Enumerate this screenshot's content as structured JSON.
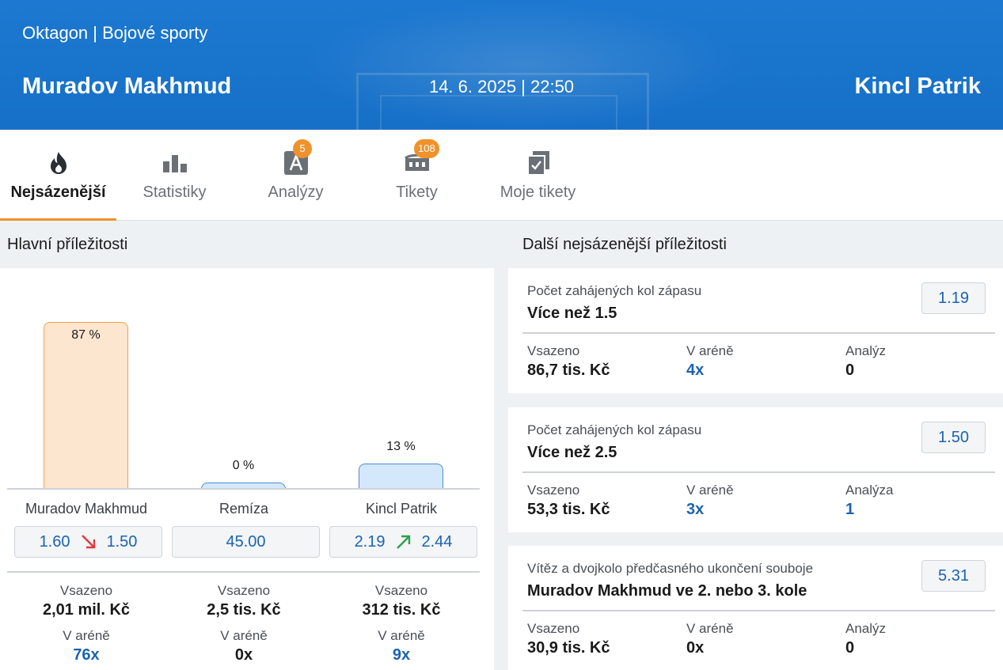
{
  "header": {
    "breadcrumb": "Oktagon | Bojové sporty",
    "fighter_left": "Muradov Makhmud",
    "datetime": "14. 6. 2025 | 22:50",
    "fighter_right": "Kincl Patrik"
  },
  "tabs": [
    {
      "label": "Nejsázenější",
      "icon": "flame-icon",
      "active": true
    },
    {
      "label": "Statistiky",
      "icon": "bar-chart-icon"
    },
    {
      "label": "Analýzy",
      "icon": "analysis-icon",
      "badge": "5"
    },
    {
      "label": "Tikety",
      "icon": "stadium-icon",
      "badge": "108"
    },
    {
      "label": "Moje tikety",
      "icon": "my-tickets-icon"
    }
  ],
  "main": {
    "title": "Hlavní příležitosti",
    "chart_data": {
      "type": "bar",
      "categories": [
        "Muradov Makhmud",
        "Remíza",
        "Kincl Patrik"
      ],
      "values": [
        87,
        0,
        13
      ],
      "value_labels": [
        "87 %",
        "0 %",
        "13 %"
      ],
      "colors": [
        "#fde6cf",
        "#d4e8fb",
        "#d4e8fb"
      ]
    },
    "options": [
      {
        "label": "Muradov Makhmud",
        "odds_old": "1.60",
        "odds_new": "1.50",
        "trend": "down",
        "vsazeno": "2,01 mil. Kč",
        "arena": "76x"
      },
      {
        "label": "Remíza",
        "odds": "45.00",
        "vsazeno": "2,5 tis. Kč",
        "arena": "0x"
      },
      {
        "label": "Kincl Patrik",
        "odds_old": "2.19",
        "odds_new": "2.44",
        "trend": "up",
        "vsazeno": "312 tis. Kč",
        "arena": "9x"
      }
    ],
    "stat_labels": {
      "vsazeno": "Vsazeno",
      "arena": "V aréně"
    }
  },
  "side": {
    "title": "Další nejsázenější příležitosti",
    "labels": {
      "vsazeno": "Vsazeno",
      "arena": "V aréně"
    },
    "cards": [
      {
        "market": "Počet zahájených kol zápasu",
        "selection": "Více než 1.5",
        "odds": "1.19",
        "vsazeno": "86,7 tis. Kč",
        "arena": "4x",
        "analyzy_label": "Analýz",
        "analyzy": "0"
      },
      {
        "market": "Počet zahájených kol zápasu",
        "selection": "Více než 2.5",
        "odds": "1.50",
        "vsazeno": "53,3 tis. Kč",
        "arena": "3x",
        "analyzy_label": "Analýza",
        "analyzy": "1"
      },
      {
        "market": "Vítěz a dvojkolo předčasného ukončení souboje",
        "selection": "Muradov Makhmud ve 2. nebo 3. kole",
        "odds": "5.31",
        "vsazeno": "30,9 tis. Kč",
        "arena": "0x",
        "analyzy_label": "Analýz",
        "analyzy": "0"
      }
    ]
  },
  "colors": {
    "header_bg": "#1670c8",
    "accent": "#f0922b",
    "link": "#1b63b0",
    "down": "#e03a3a",
    "up": "#2ea04f"
  }
}
